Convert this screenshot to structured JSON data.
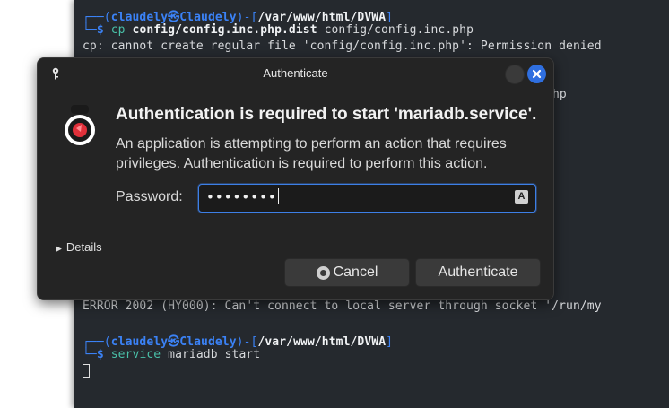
{
  "terminal": {
    "prompt1": {
      "user": "claudely",
      "at": "㉿",
      "host": "Claudely",
      "path": "/var/www/html/DVWA",
      "cmd": "cp",
      "arg1": "config/config.inc.php.dist",
      "arg2": "config/config.inc.php"
    },
    "error_cp": "cp: cannot create regular file 'config/config.inc.php': Permission denied",
    "partial_hp": "hp",
    "error_mysql": "ERROR 2002 (HY000): Can't connect to local server through socket '/run/my",
    "prompt2": {
      "user": "claudely",
      "at": "㉿",
      "host": "Claudely",
      "path": "/var/www/html/DVWA",
      "cmd": "service",
      "args": "mariadb start"
    },
    "prompt_sigil": "$"
  },
  "dialog": {
    "title": "Authenticate",
    "heading": "Authentication is required to start 'mariadb.service'.",
    "description": "An application is attempting to perform an action that requires privileges. Authentication is required to perform this action.",
    "password_label": "Password:",
    "password_value": "••••••••",
    "capslock_glyph": "A",
    "details_label": "Details",
    "cancel_label": "Cancel",
    "authenticate_label": "Authenticate"
  },
  "colors": {
    "terminal_bg": "#25292e",
    "prompt_blue": "#3b82f6",
    "dialog_bg": "#242424",
    "accent": "#3d7fe6",
    "auth_icon_red": "#e0303a"
  },
  "icons": [
    "key-icon",
    "minimize-icon",
    "close-icon",
    "authentication-icon",
    "capslock-icon",
    "disclosure-triangle-icon",
    "cancel-icon"
  ]
}
